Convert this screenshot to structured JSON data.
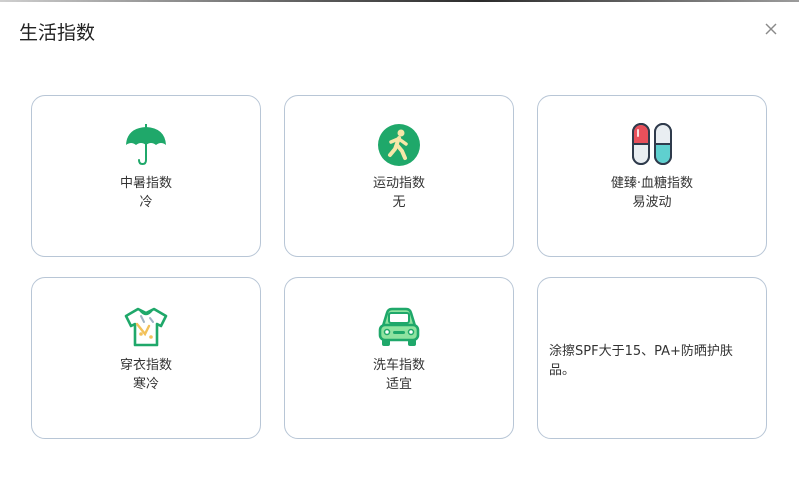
{
  "dialog": {
    "title": "生活指数"
  },
  "cards": [
    {
      "name": "中暑指数",
      "value": "冷",
      "icon": "umbrella-icon"
    },
    {
      "name": "运动指数",
      "value": "无",
      "icon": "running-person-icon"
    },
    {
      "name": "健臻·血糖指数",
      "value": "易波动",
      "icon": "capsule-icon"
    },
    {
      "name": "穿衣指数",
      "value": "寒冷",
      "icon": "shirt-icon"
    },
    {
      "name": "洗车指数",
      "value": "适宜",
      "icon": "car-icon"
    }
  ],
  "tip": {
    "text": "涂擦SPF大于15、PA+防晒护肤品。"
  },
  "colors": {
    "accent_green": "#1fa86a",
    "card_border": "#b8c6d6",
    "capsule_red": "#e8505b",
    "capsule_teal": "#5fd0cf"
  }
}
